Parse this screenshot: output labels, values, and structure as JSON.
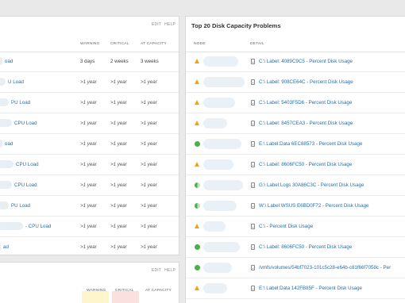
{
  "left_panel": {
    "edit": "EDIT",
    "help": "HELP",
    "columns": {
      "warning": "WARNING",
      "critical": "CRITICAL",
      "at_capacity": "AT CAPACITY"
    },
    "rows": [
      {
        "name": "oad",
        "warning": "3 days",
        "critical": "2 weeks",
        "at_capacity": "3 weeks"
      },
      {
        "name": "U Load",
        "warning": ">1 year",
        "critical": ">1 year",
        "at_capacity": ">1 year"
      },
      {
        "name": "PU Load",
        "warning": ">1 year",
        "critical": ">1 year",
        "at_capacity": ">1 year"
      },
      {
        "name": "CPU Load",
        "warning": ">1 year",
        "critical": ">1 year",
        "at_capacity": ">1 year"
      },
      {
        "name": "oad",
        "warning": ">1 year",
        "critical": ">1 year",
        "at_capacity": ">1 year"
      },
      {
        "name": "CPU Load",
        "warning": ">1 year",
        "critical": ">1 year",
        "at_capacity": ">1 year"
      },
      {
        "name": "CPU Load",
        "warning": ">1 year",
        "critical": ">1 year",
        "at_capacity": ">1 year"
      },
      {
        "name": "PU Load",
        "warning": ">1 year",
        "critical": ">1 year",
        "at_capacity": ">1 year"
      },
      {
        "name": "- CPU Load",
        "warning": ">1 year",
        "critical": ">1 year",
        "at_capacity": ">1 year"
      },
      {
        "name": "ad",
        "warning": ">1 year",
        "critical": ">1 year",
        "at_capacity": ">1 year"
      }
    ]
  },
  "left_panel_2": {
    "edit": "EDIT",
    "help": "HELP",
    "columns": {
      "warning": "WARNING",
      "critical": "CRITICAL",
      "at_capacity": "AT CAPACITY"
    }
  },
  "right_panel": {
    "title": "Top 20 Disk Capacity Problems",
    "columns": {
      "node": "NODE",
      "detail": "DETAIL"
    },
    "rows": [
      {
        "status": "warning",
        "detail": "C:\\ Label: 4089C9C5 - Percent Disk Usage"
      },
      {
        "status": "warning",
        "detail": "C:\\ Label: 908CE64C - Percent Disk Usage"
      },
      {
        "status": "warning",
        "detail": "C:\\ Label: 5403F5D6 - Percent Disk Usage"
      },
      {
        "status": "warning",
        "detail": "C:\\ Label: 8457CEA3 - Percent Disk Usage"
      },
      {
        "status": "up",
        "detail": "E:\\ Label:Data 6EC88573 - Percent Disk Usage"
      },
      {
        "status": "warning",
        "detail": "C:\\ Label: 8606FC50 - Percent Disk Usage"
      },
      {
        "status": "partial",
        "detail": "G:\\ Label:Logs 30A86C3C - Percent Disk Usage"
      },
      {
        "status": "partial",
        "detail": "W:\\ Label:WSUS E6BD0F72 - Percent Disk Usage"
      },
      {
        "status": "warning",
        "detail": "C:\\ - Percent Disk Usage"
      },
      {
        "status": "up",
        "detail": "C:\\ Label: 8606FC50 - Percent Disk Usage"
      },
      {
        "status": "up",
        "detail": "/vmfs/volumes/54bf7023-101c5c28-e64b-c81f66f7058c - Per"
      },
      {
        "status": "warning",
        "detail": "E:\\ Label:Data 142FB85F - Percent Disk Usage"
      }
    ]
  }
}
